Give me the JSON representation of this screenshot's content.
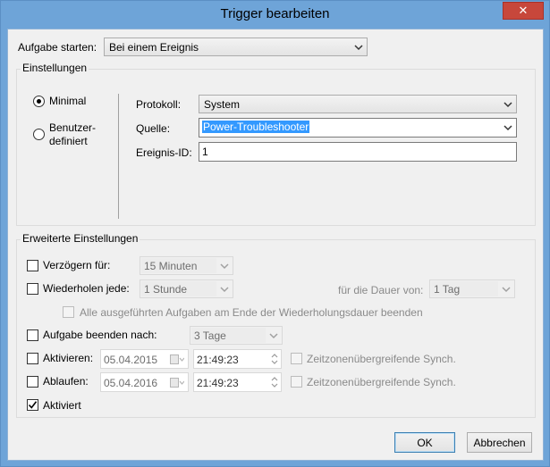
{
  "window": {
    "title": "Trigger bearbeiten",
    "close_glyph": "✕"
  },
  "start": {
    "label": "Aufgabe starten:",
    "value": "Bei einem Ereignis"
  },
  "settings": {
    "group_title": "Einstellungen",
    "radio_minimal": "Minimal",
    "radio_custom_line1": "Benutzer-",
    "radio_custom_line2": "definiert",
    "selected": "minimal",
    "protokoll_label": "Protokoll:",
    "protokoll_value": "System",
    "quelle_label": "Quelle:",
    "quelle_value": "Power-Troubleshooter",
    "ereignis_label": "Ereignis-ID:",
    "ereignis_value": "1"
  },
  "advanced": {
    "group_title": "Erweiterte Einstellungen",
    "delay_label": "Verzögern für:",
    "delay_value": "15 Minuten",
    "repeat_label": "Wiederholen jede:",
    "repeat_value": "1 Stunde",
    "duration_label": "für die Dauer von:",
    "duration_value": "1 Tag",
    "stop_all_label": "Alle ausgeführten Aufgaben am Ende der Wiederholungsdauer beenden",
    "end_after_label": "Aufgabe beenden nach:",
    "end_after_value": "3 Tage",
    "activate_label": "Aktivieren:",
    "activate_date": "05.04.2015",
    "activate_time": "21:49:23",
    "expire_label": "Ablaufen:",
    "expire_date": "05.04.2016",
    "expire_time": "21:49:23",
    "sync_label": "Zeitzonenübergreifende Synch.",
    "enabled_label": "Aktiviert",
    "enabled_checked": true
  },
  "buttons": {
    "ok": "OK",
    "cancel": "Abbrechen"
  },
  "colors": {
    "titlebar": "#6ea4d8",
    "close": "#c7473b",
    "selection": "#3399ff"
  }
}
